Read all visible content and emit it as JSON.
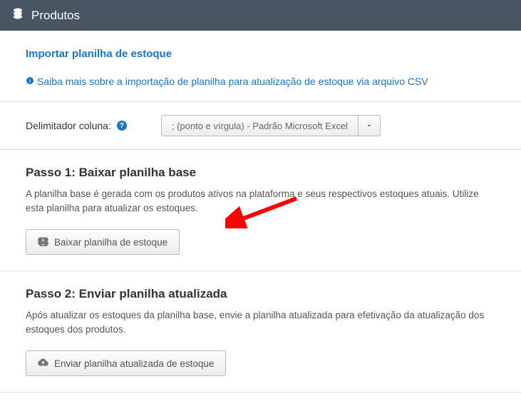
{
  "header": {
    "title": "Produtos"
  },
  "import": {
    "title": "Importar planilha de estoque",
    "info_link": "Saiba mais sobre a importação de planilha para atualização de estoque via arquivo CSV"
  },
  "delimiter": {
    "label": "Delimitador coluna:",
    "selected": "; (ponto e vírgula) - Padrão Microsoft Excel"
  },
  "step1": {
    "title": "Passo 1: Baixar planilha base",
    "description": "A planilha base é gerada com os produtos ativos na plataforma e seus respectivos estoques atuais. Utilize esta planilha para atualizar os estoques.",
    "button": "Baixar planilha de estoque"
  },
  "step2": {
    "title": "Passo 2: Enviar planilha atualizada",
    "description": "Após atualizar os estoques da planilha base, envie a planilha atualizada para efetivação da atualização dos estoques dos produtos.",
    "button": "Enviar planilha atualizada de estoque"
  }
}
